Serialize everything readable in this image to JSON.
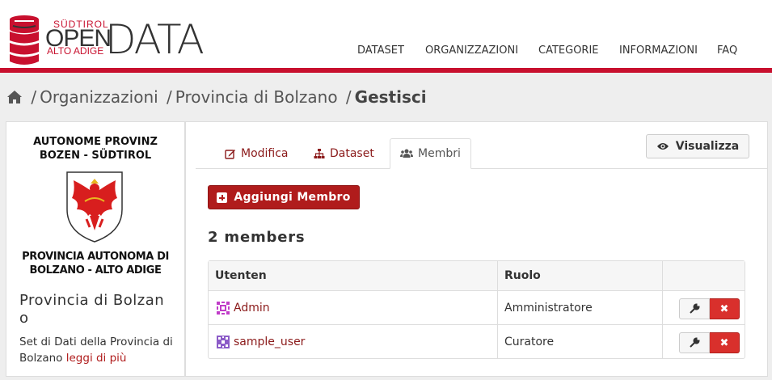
{
  "brand": {
    "top": "SÜDTIROL",
    "open": "OPEN",
    "bottom": "ALTO ADIGE",
    "data": "DATA",
    "accent_color": "#c8102e"
  },
  "nav": {
    "items": [
      {
        "label": "DATASET"
      },
      {
        "label": "ORGANIZZAZIONI"
      },
      {
        "label": "CATEGORIE"
      },
      {
        "label": "INFORMAZIONI"
      },
      {
        "label": "FAQ"
      }
    ]
  },
  "breadcrumb": {
    "home_icon": "home-icon",
    "sep": "/",
    "items": [
      "Organizzazioni",
      "Provincia di Bolzano"
    ],
    "current": "Gestisci"
  },
  "sidebar": {
    "logo_top_line1": "AUTONOME PROVINZ",
    "logo_top_line2": "BOZEN - SÜDTIROL",
    "logo_bottom_line1": "PROVINCIA AUTONOMA DI",
    "logo_bottom_line2": "BOLZANO - ALTO ADIGE",
    "org_name": "Provincia di Bolzano",
    "description": "Set di Dati della Provincia di Bolzano",
    "read_more": "leggi di più"
  },
  "tabs": [
    {
      "label": "Modifica",
      "icon": "edit-icon"
    },
    {
      "label": "Dataset",
      "icon": "sitemap-icon"
    },
    {
      "label": "Membri",
      "icon": "group-icon",
      "active": true
    }
  ],
  "view_button": {
    "label": "Visualizza",
    "icon": "eye-icon"
  },
  "add_member": {
    "label": "Aggiungi Membro",
    "icon": "plus-square-icon"
  },
  "members_count": "2 members",
  "table": {
    "headers": [
      "Utenten",
      "Ruolo",
      ""
    ],
    "rows": [
      {
        "user": "Admin",
        "role": "Amministratore",
        "avatar_color": "#c03cc8"
      },
      {
        "user": "sample_user",
        "role": "Curatore",
        "avatar_color": "#8c5cc8"
      }
    ]
  }
}
